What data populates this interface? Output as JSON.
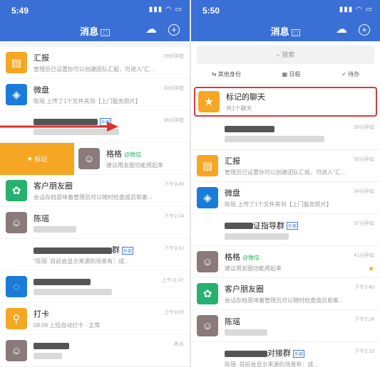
{
  "left": {
    "time": "5:49",
    "title": "消息",
    "rows": [
      {
        "name": "汇报",
        "preview": "管理员已设置你可以创建团队汇报，可进入\"汇...",
        "time": "29分钟前"
      },
      {
        "name": "微盘",
        "preview": "陈瑶 上传了1个文件夹到【上门服务照片】",
        "time": "33分钟前"
      },
      {
        "name": "",
        "preview": "",
        "time": "36分钟前",
        "tag": "外部"
      },
      {
        "name": "格格",
        "wechat": "@微信",
        "preview": "建议用友圈功能用起来",
        "time": "",
        "mark": "标记"
      },
      {
        "name": "客户朋友圈",
        "preview": "会话存档意味着管理员可以随时检查成员和客...",
        "time": "下午3:40"
      },
      {
        "name": "陈瑶",
        "preview": "",
        "time": "下午2:24"
      },
      {
        "name": "群",
        "preview": "\"陈瑶: 目前会显示来源的场景有：成...",
        "time": "下午3:10",
        "tag": "外部"
      },
      {
        "name": "",
        "preview": "",
        "time": "上午11:47"
      },
      {
        "name": "打卡",
        "preview": "09:09 上班自动打卡 · 正常",
        "time": "上午9:09"
      },
      {
        "name": "",
        "preview": "",
        "time": "昨天"
      }
    ]
  },
  "right": {
    "time": "5:50",
    "title": "消息",
    "search_placeholder": "搜索",
    "tools": [
      "其他身份",
      "日程",
      "待办"
    ],
    "starred": {
      "name": "标记的聊天",
      "preview": "共1个聊天"
    },
    "rows": [
      {
        "name": "",
        "preview": "",
        "time": "28分钟前"
      },
      {
        "name": "汇报",
        "preview": "管理员已设置你可以创建团队汇报，可进入\"汇...",
        "time": "30分钟前"
      },
      {
        "name": "微盘",
        "preview": "陈瑶 上传了1个文件夹到【上门服务照片】",
        "time": "34分钟前"
      },
      {
        "name": "证指导群",
        "preview": "",
        "time": "37分钟前",
        "tag": "外部"
      },
      {
        "name": "格格",
        "wechat": "@微信",
        "preview": "建议用友圈功能用起来",
        "time": "41分钟前"
      },
      {
        "name": "客户朋友圈",
        "preview": "会话存档意味着管理员可以随时检查成员和客...",
        "time": "下午3:40"
      },
      {
        "name": "陈瑶",
        "preview": "",
        "time": "下午2:24"
      },
      {
        "name": "对接群",
        "preview": "陈瑶: 目前会显示来源的场景有：成...",
        "time": "下午2:10",
        "tag": "外部"
      }
    ]
  },
  "icons": {
    "cloud": "cloud-icon",
    "plus": "plus-icon",
    "search": "search-icon",
    "star": "star-icon"
  }
}
